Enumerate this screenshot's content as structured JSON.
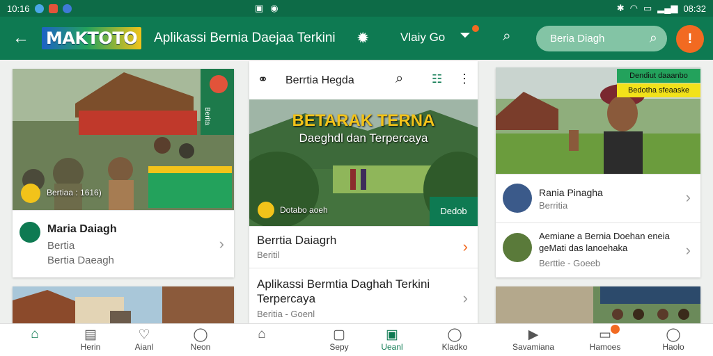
{
  "status": {
    "time": "10:16",
    "right_time": "08:32"
  },
  "appbar": {
    "logo": "MAKTOTO",
    "title": "Aplikassi Bernia Daejaa Terkini",
    "view_label": "Vlaiy Go",
    "search_placeholder": "Beria Diagh"
  },
  "card_left": {
    "badge_text": "Bertiaa : 1616)",
    "banner_text": "Berita",
    "item": {
      "title": "Maria Daiagh",
      "line1": "Bertia",
      "line2": "Bertia Daeagh"
    }
  },
  "card_mid": {
    "header_title": "Berrtia Hegda",
    "headline_line1": "BETARAK TERNA",
    "headline_line2": "Daeghdl dan Terpercaya",
    "author": "Dotabo aoeh",
    "cta": "Dedob",
    "item1": {
      "title": "Berrtia Daiagrh",
      "sub": "Beritil"
    },
    "item2": {
      "title": "Aplikassi Bermtia Daghah Terkini Terpercaya",
      "meta": "Beritia - Goenl"
    }
  },
  "card_right": {
    "tag1": "Dendiut daaanbo",
    "tag2": "Bedotha sfeaaske",
    "item1": {
      "title": "Rania Pinagha",
      "sub": "Berritia"
    },
    "item2": {
      "title": "Aemiane a Bernia Doehan eneia geMati das lanoehaka",
      "meta": "Berttie - Goeeb"
    }
  },
  "bottom_nav": [
    {
      "label": "",
      "icon": "home-icon"
    },
    {
      "label": "Herin",
      "icon": "news-icon"
    },
    {
      "label": "Aianl",
      "icon": "heart-icon"
    },
    {
      "label": "Neon",
      "icon": "user-icon"
    },
    {
      "label": "",
      "icon": "house-icon"
    },
    {
      "label": "Sepy",
      "icon": "chat-icon"
    },
    {
      "label": "Ueanl",
      "icon": "bookmark-icon"
    },
    {
      "label": "Kladko",
      "icon": "person-icon"
    },
    {
      "label": "Savamiana",
      "icon": "video-icon"
    },
    {
      "label": "Hamoes",
      "icon": "bell-icon"
    },
    {
      "label": "Haolo",
      "icon": "profile-icon"
    }
  ],
  "colors": {
    "primary": "#0e7a52",
    "accent": "#f26a21",
    "status_bar": "#0d6b47"
  }
}
